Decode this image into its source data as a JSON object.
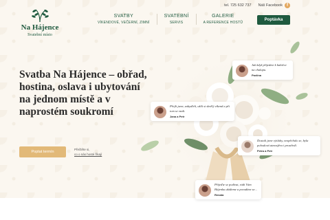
{
  "brand": {
    "name": "Na Hájence",
    "tagline": "Svatební místo"
  },
  "topbar": {
    "phone": "tel. 725 632 737",
    "facebook_label": "Náš Facebook",
    "facebook_icon": "facebook-icon"
  },
  "nav": [
    {
      "title": "SVATBY",
      "sub": "VÍKENDOVÉ, VEČERNÍ, ZIMNÍ"
    },
    {
      "title": "SVATEBNÍ",
      "sub": "SERVIS"
    },
    {
      "title": "GALERIE",
      "sub": "A REFERENCE HOSTŮ"
    }
  ],
  "cta_top": "Poptávka",
  "hero": {
    "title": "Svatba Na Hájence – obřad, hostina, oslava i ubytování na jednom místě a v naprostém soukromí",
    "cta": "Poptat termín",
    "note_line1": "Přečtěte si,",
    "note_line2": "co o nás hosté říkají"
  },
  "reviews": [
    {
      "text": "Jak když přijedete k babičce na chalupu.",
      "name": "Pavlína"
    },
    {
      "text": "Přejli jsme, zabydleli, užili si skvělý víkend a při tom se vzali.",
      "name": "Jana a Petr"
    },
    {
      "text": "Dostali jsme výsluhy, nespěchalo se, byla pohodová atmosféra i prostředí.",
      "name": "Petra a Petr"
    },
    {
      "text": "Přijeďte se podívat, rádi Vám Hájenku ukážeme a poradíme se...",
      "name": "Renata"
    }
  ],
  "colors": {
    "brand_green": "#1f5a3f",
    "accent_gold": "#e2b978",
    "background": "#fbf7f0"
  }
}
